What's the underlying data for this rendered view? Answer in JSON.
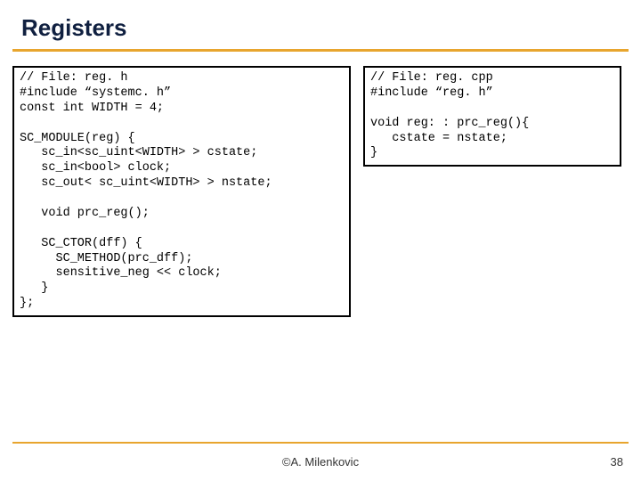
{
  "title": "Registers",
  "code_left": "// File: reg. h\n#include “systemc. h”\nconst int WIDTH = 4;\n\nSC_MODULE(reg) {\n   sc_in<sc_uint<WIDTH> > cstate;\n   sc_in<bool> clock;\n   sc_out< sc_uint<WIDTH> > nstate;\n\n   void prc_reg();\n\n   SC_CTOR(dff) {\n     SC_METHOD(prc_dff);\n     sensitive_neg << clock;\n   }\n};",
  "code_right": "// File: reg. cpp\n#include “reg. h”\n\nvoid reg: : prc_reg(){\n   cstate = nstate;\n}",
  "footer_author": "©A. Milenkovic",
  "footer_page": "38"
}
